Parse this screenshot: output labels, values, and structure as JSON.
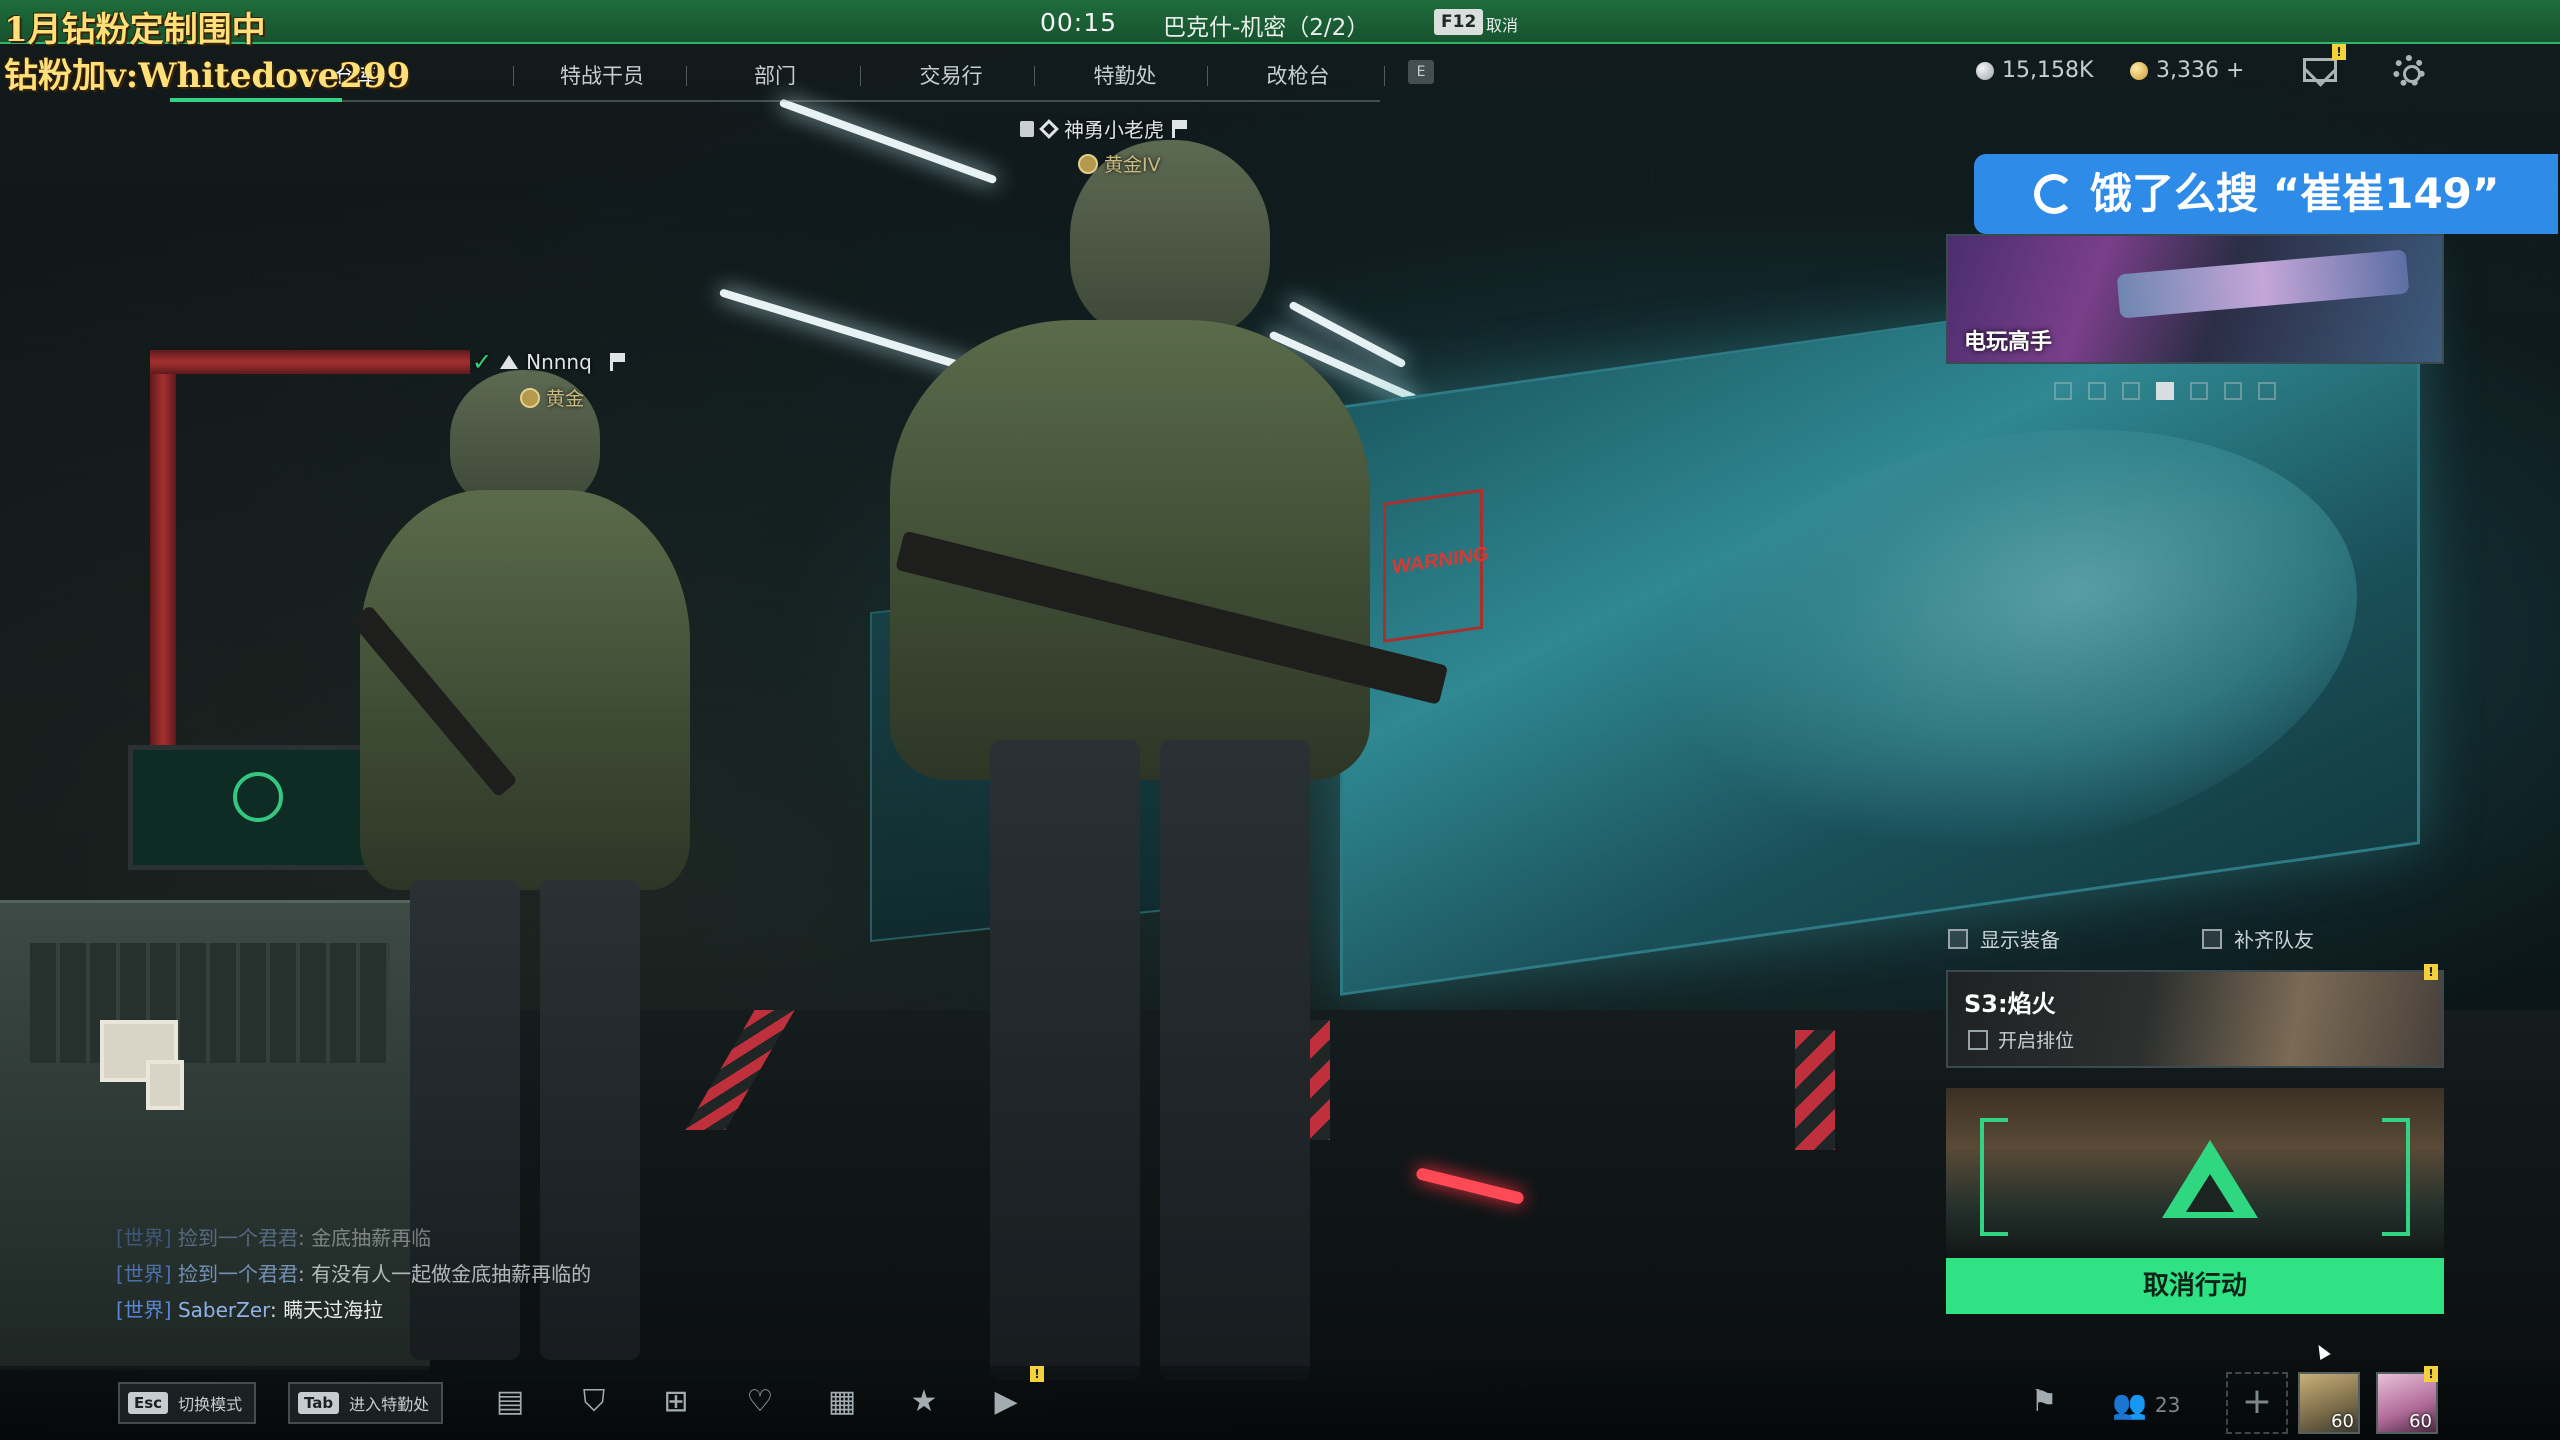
{
  "overlay": {
    "line1": "1月钻粉定制围中",
    "line2": "钻粉加v:Whitedove299"
  },
  "topbar": {
    "timer": "00:15",
    "mode": "巴克什-机密（2/2）",
    "key": "F12",
    "cancel": "取消"
  },
  "nav": {
    "items": [
      {
        "label": "仓库"
      },
      {
        "label": "特战干员"
      },
      {
        "label": "部门"
      },
      {
        "label": "交易行"
      },
      {
        "label": "特勤处"
      },
      {
        "label": "改枪台"
      }
    ],
    "extra_key": "E"
  },
  "currency": {
    "silver": "15,158K",
    "gold": "3,336 +"
  },
  "players": {
    "leader": {
      "name": "神勇小老虎",
      "rank": "黄金IV"
    },
    "teammate": {
      "name": "Nnnnq",
      "rank": "黄金"
    }
  },
  "promo": {
    "banner": "饿了么搜 “崔崔149”",
    "ad_title": "电玩高手"
  },
  "options": {
    "show_gear": "显示装备",
    "fill_team": "补齐队友"
  },
  "season": {
    "name": "S3:焰火",
    "ranked": "开启排位"
  },
  "action": {
    "cancel": "取消行动"
  },
  "scene_text": {
    "warning": "WARNING"
  },
  "chat": [
    {
      "channel": "[世界]",
      "who": "捡到一个君君",
      "msg": "金底抽薪再临"
    },
    {
      "channel": "[世界]",
      "who": "捡到一个君君",
      "msg": "有没有人一起做金底抽薪再临的"
    },
    {
      "channel": "[世界]",
      "who": "SaberZer",
      "msg": "瞒天过海拉"
    }
  ],
  "bottom": {
    "esc_key": "Esc",
    "esc_label": "切换模式",
    "tab_key": "Tab",
    "tab_label": "进入特勤处",
    "party_count": "23",
    "avatar1_level": "60",
    "avatar2_level": "60"
  },
  "icons": [
    "chat-icon",
    "shield-icon",
    "cart-icon",
    "heart-badge-icon",
    "calendar-icon",
    "star-box-icon",
    "play-icon",
    "flag-icon",
    "people-icon",
    "mail-icon",
    "gear-icon"
  ],
  "colors": {
    "accent": "#32d483",
    "top_strip": "#1e6d3c",
    "promo": "#2e8be8",
    "chat_channel": "#5a86d8"
  }
}
